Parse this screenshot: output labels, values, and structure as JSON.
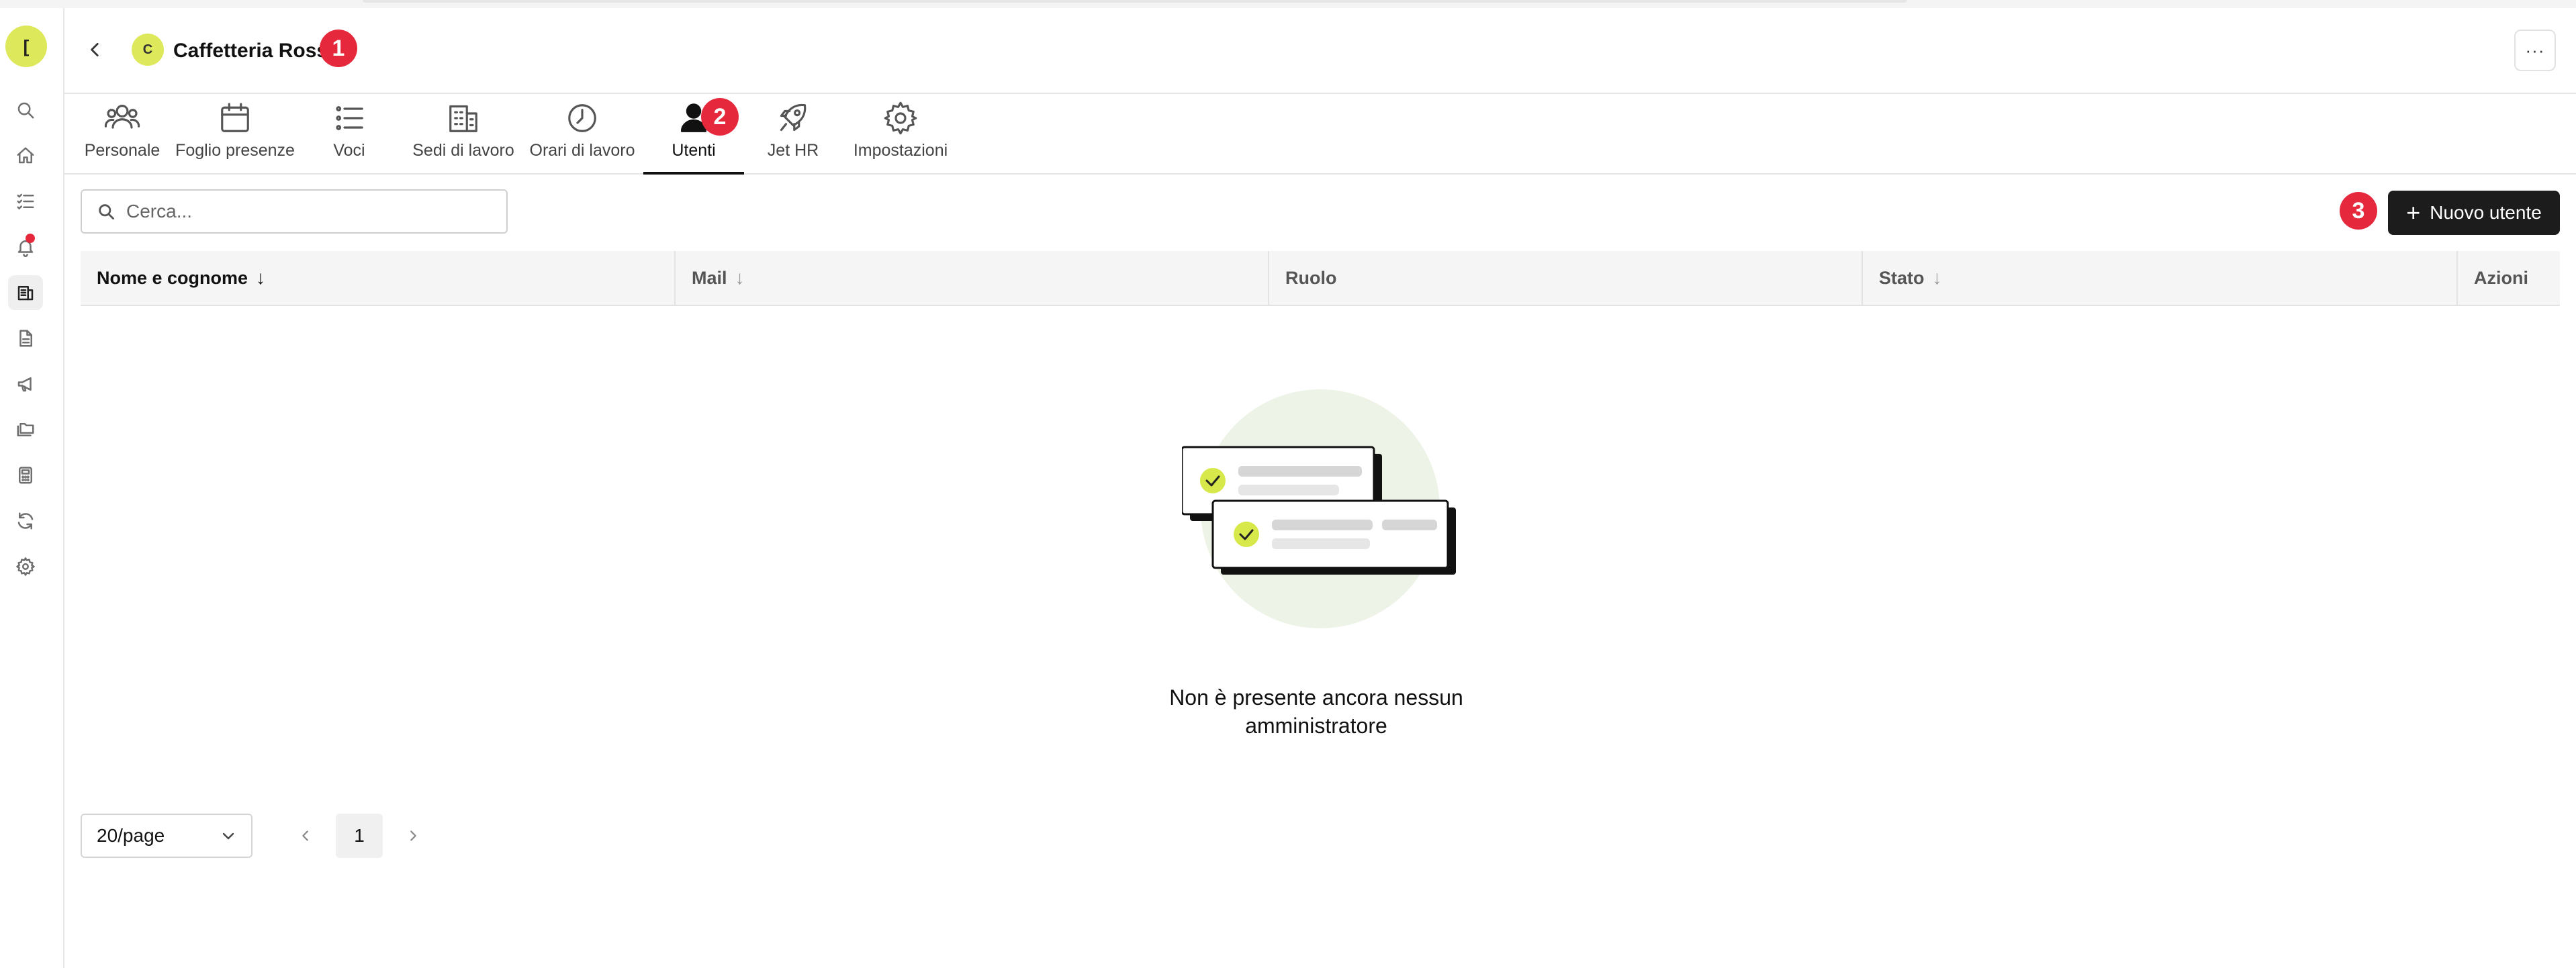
{
  "header": {
    "avatar_letter": "C",
    "company_name": "Caffetteria Rossi",
    "more_label": "···"
  },
  "sidebar": {
    "avatar_letter": "[",
    "items": [
      {
        "icon": "search-icon"
      },
      {
        "icon": "home-icon"
      },
      {
        "icon": "checklist-icon"
      },
      {
        "icon": "bell-icon",
        "notification_dot": true
      },
      {
        "icon": "company-icon",
        "active": true
      },
      {
        "icon": "document-icon"
      },
      {
        "icon": "megaphone-icon"
      },
      {
        "icon": "folders-icon"
      },
      {
        "icon": "calculator-icon"
      },
      {
        "icon": "sync-icon"
      },
      {
        "icon": "gear-icon"
      }
    ]
  },
  "tabs": [
    {
      "label": "Personale",
      "icon": "people-icon"
    },
    {
      "label": "Foglio presenze",
      "icon": "calendar-icon"
    },
    {
      "label": "Voci",
      "icon": "list-icon"
    },
    {
      "label": "Sedi di lavoro",
      "icon": "building-icon"
    },
    {
      "label": "Orari di lavoro",
      "icon": "clock-icon"
    },
    {
      "label": "Utenti",
      "icon": "user-icon",
      "active": true
    },
    {
      "label": "Jet HR",
      "icon": "rocket-icon"
    },
    {
      "label": "Impostazioni",
      "icon": "gear-icon"
    }
  ],
  "search": {
    "placeholder": "Cerca..."
  },
  "new_user_button": {
    "label": "Nuovo utente"
  },
  "table": {
    "columns": [
      {
        "label": "Nome e cognome",
        "sort": "↓"
      },
      {
        "label": "Mail",
        "sort": "↓"
      },
      {
        "label": "Ruolo",
        "sort": ""
      },
      {
        "label": "Stato",
        "sort": "↓"
      },
      {
        "label": "Azioni",
        "sort": ""
      }
    ],
    "rows": []
  },
  "empty_state": {
    "line1": "Non è presente ancora nessun",
    "line2": "amministratore"
  },
  "pagination": {
    "page_size": "20/page",
    "current_page": "1"
  },
  "annotations": {
    "badge1": "1",
    "badge2": "2",
    "badge3": "3",
    "color": "#e5283c"
  },
  "colors": {
    "accent": "#dde85a",
    "primary_button": "#1c1c1c",
    "notification": "#e5283c"
  }
}
